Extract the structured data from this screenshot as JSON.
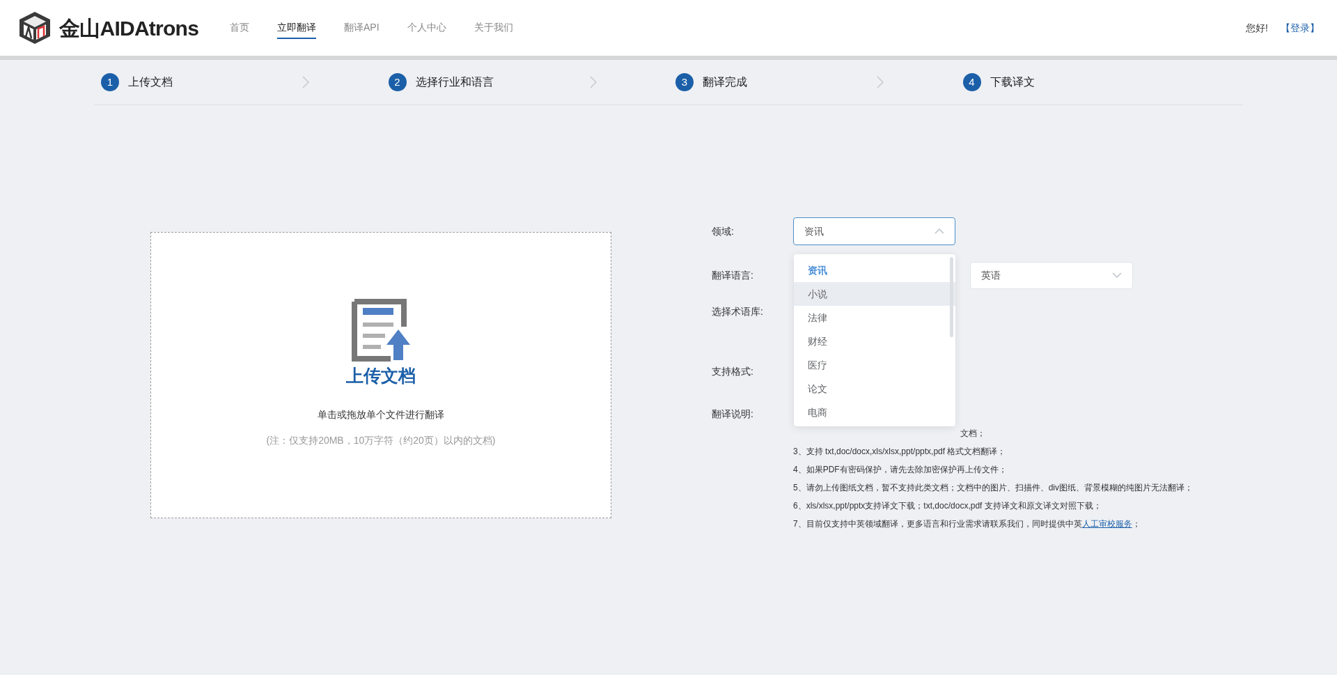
{
  "header": {
    "logo_text": "金山AIDAtrons",
    "nav": [
      {
        "label": "首页",
        "selected": false
      },
      {
        "label": "立即翻译",
        "selected": true
      },
      {
        "label": "翻译API",
        "selected": false
      },
      {
        "label": "个人中心",
        "selected": false
      },
      {
        "label": "关于我们",
        "selected": false
      }
    ],
    "greeting": "您好!",
    "login": "【登录】"
  },
  "steps": [
    {
      "number": "1",
      "label": "上传文档"
    },
    {
      "number": "2",
      "label": "选择行业和语言"
    },
    {
      "number": "3",
      "label": "翻译完成"
    },
    {
      "number": "4",
      "label": "下载译文"
    }
  ],
  "upload": {
    "title": "上传文档",
    "hint": "单击或拖放单个文件进行翻译",
    "note": "(注：仅支持20MB，10万字符（约20页）以内的文档)"
  },
  "form": {
    "labels": [
      "领域:",
      "翻译语言:",
      "选择术语库:",
      "支持格式:",
      "翻译说明:"
    ],
    "domain_value": "资讯",
    "target_language": "英语",
    "dropdown": [
      {
        "label": "资讯",
        "selected": true,
        "hovered": false
      },
      {
        "label": "小说",
        "selected": false,
        "hovered": true
      },
      {
        "label": "法律",
        "selected": false,
        "hovered": false
      },
      {
        "label": "财经",
        "selected": false,
        "hovered": false
      },
      {
        "label": "医疗",
        "selected": false,
        "hovered": false
      },
      {
        "label": "论文",
        "selected": false,
        "hovered": false
      },
      {
        "label": "电商",
        "selected": false,
        "hovered": false
      }
    ],
    "notes": [
      {
        "text": "文档；"
      },
      {
        "text": "3、支持 txt,doc/docx,xls/xlsx,ppt/pptx,pdf 格式文档翻译；"
      },
      {
        "text": "4、如果PDF有密码保护，请先去除加密保护再上传文件；"
      },
      {
        "text": "5、请勿上传图纸文档，暂不支持此类文档；文档中的图片、扫描件、div图纸、背景模糊的纯图片无法翻译；"
      },
      {
        "text": "6、xls/xlsx,ppt/pptx支持译文下载；txt,doc/docx,pdf 支持译文和原文译文对照下载；"
      },
      {
        "text": "7、目前仅支持中英领域翻译，更多语言和行业需求请联系我们，同时提供中英",
        "link": "人工审校服务",
        "after": "；"
      }
    ]
  }
}
